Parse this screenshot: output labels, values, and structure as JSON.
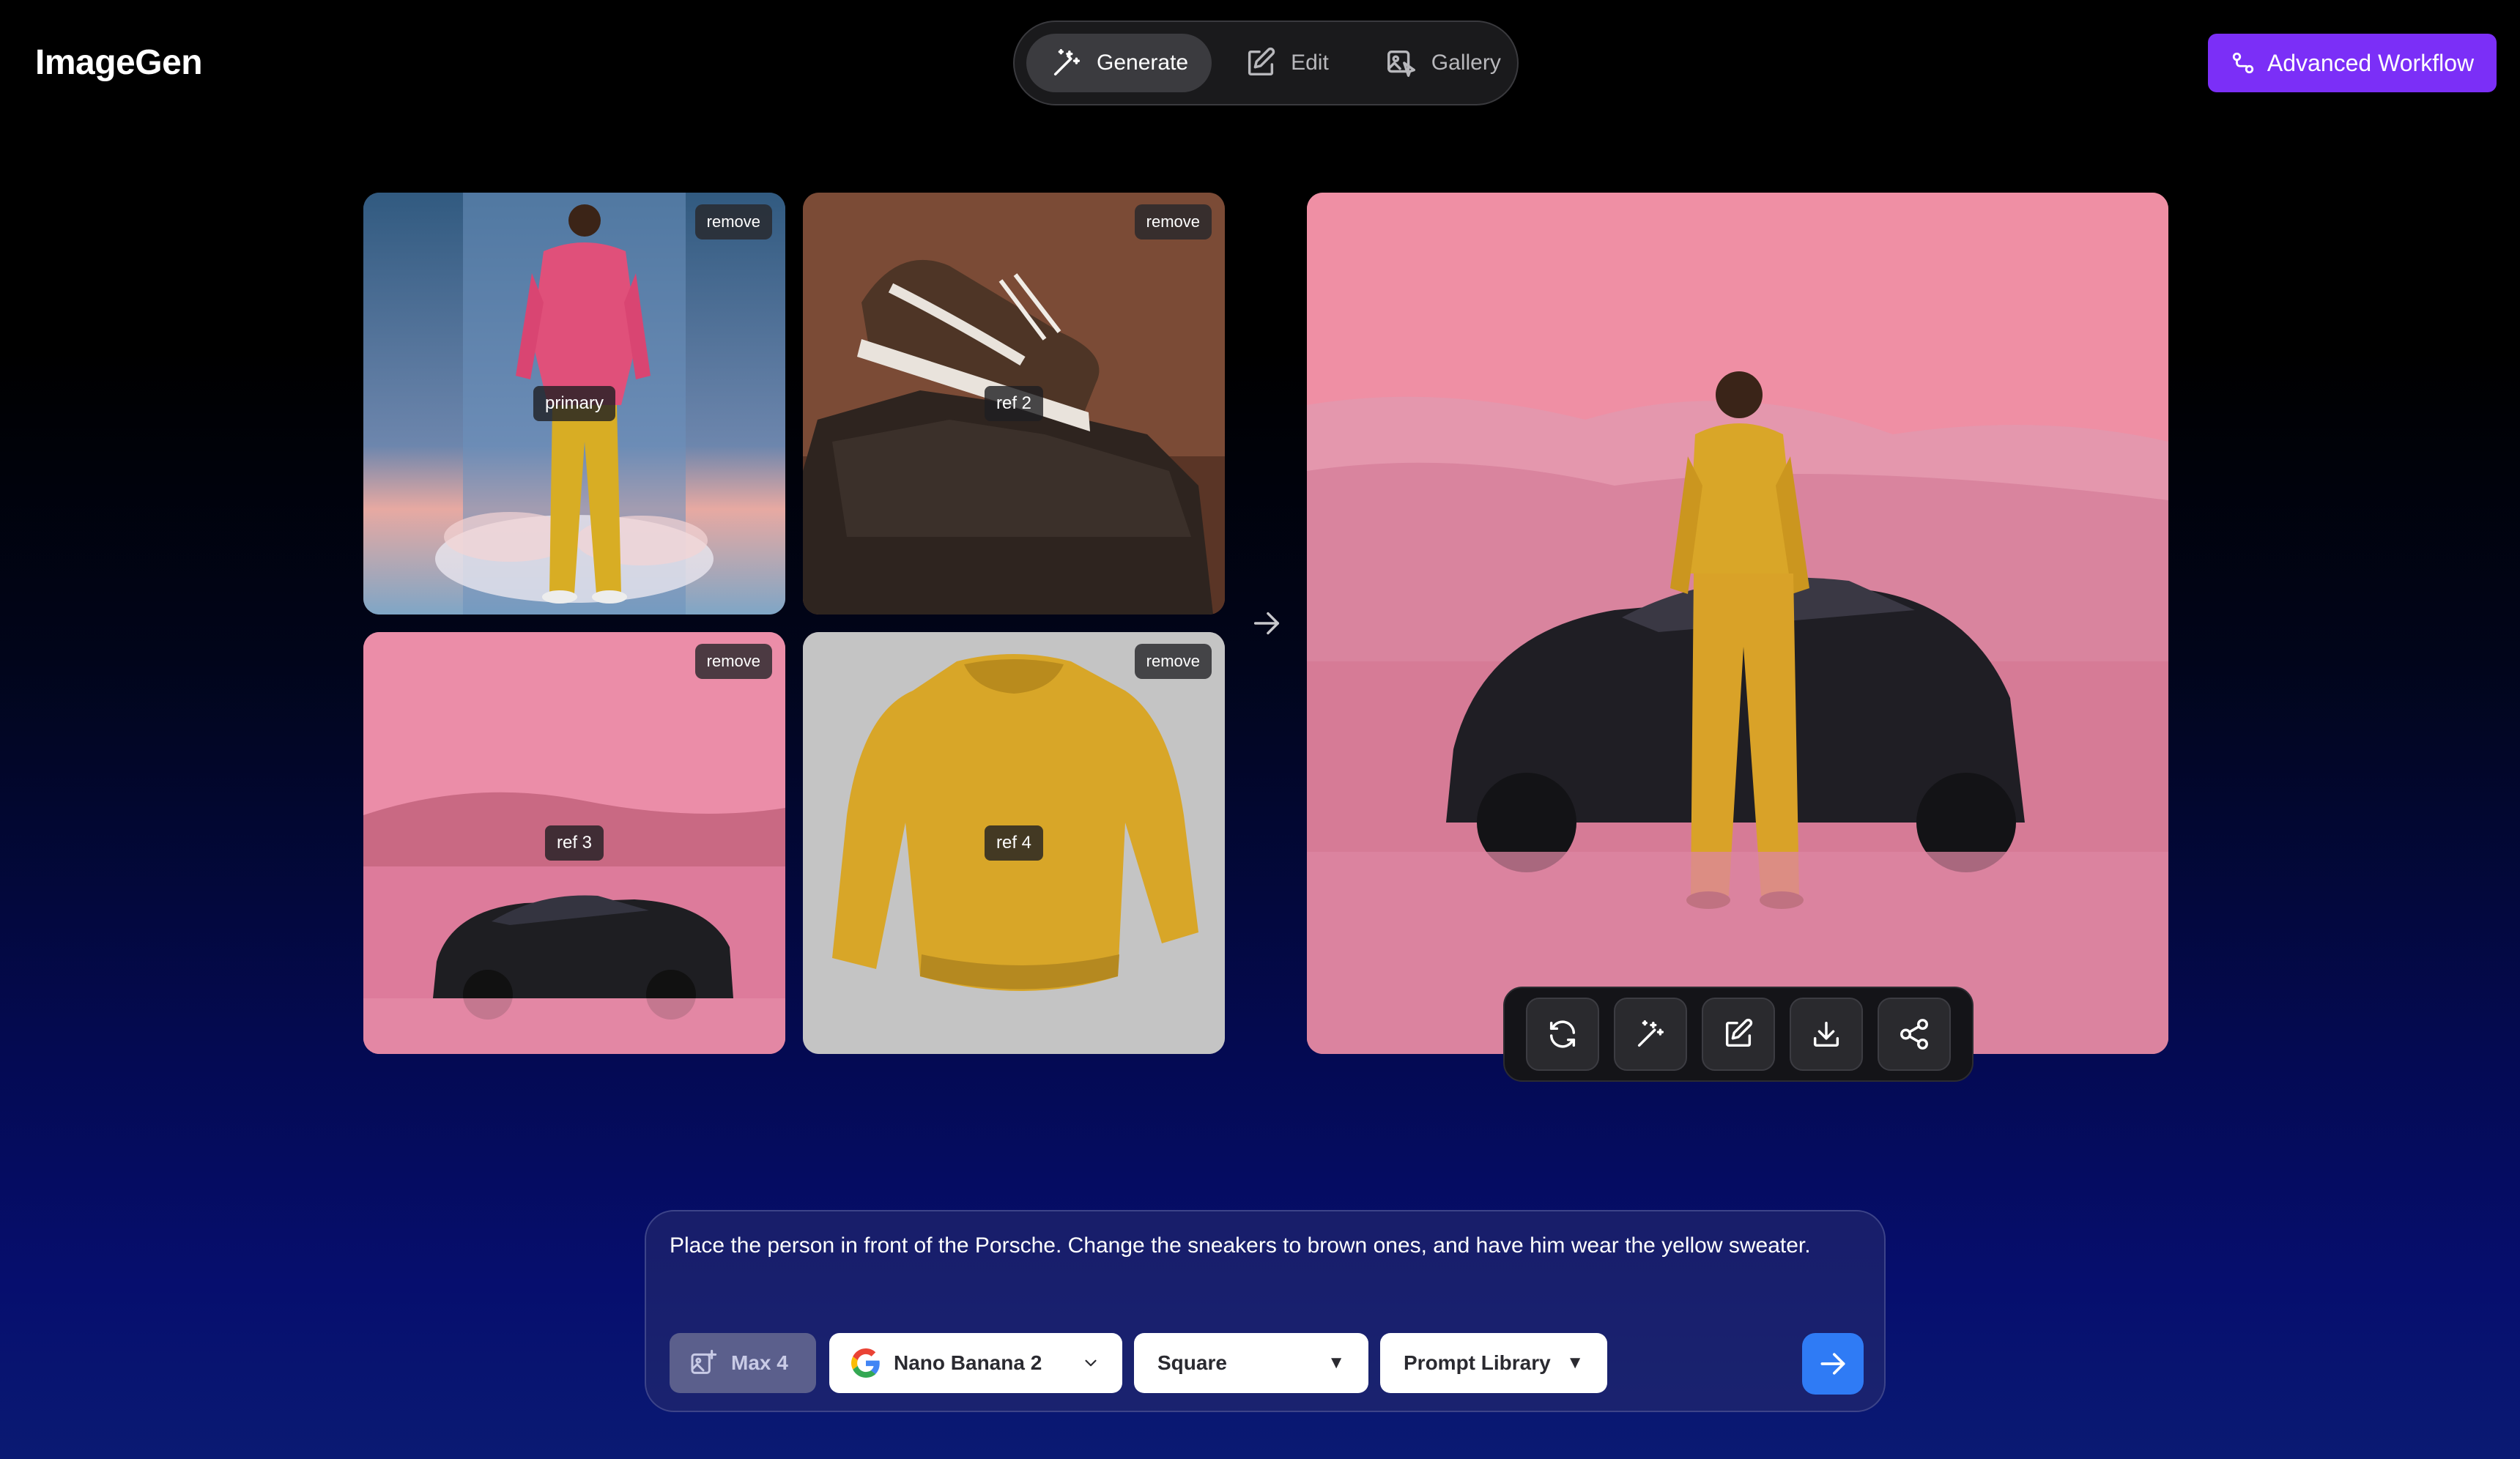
{
  "app": {
    "title": "ImageGen"
  },
  "nav": {
    "tabs": [
      {
        "label": "Generate",
        "icon": "magic-wand-icon",
        "active": true
      },
      {
        "label": "Edit",
        "icon": "edit-icon",
        "active": false
      },
      {
        "label": "Gallery",
        "icon": "gallery-icon",
        "active": false
      }
    ]
  },
  "header": {
    "advanced_label": "Advanced Workflow",
    "advanced_icon": "workflow-icon",
    "accent": "#7b2ff7"
  },
  "references": {
    "remove_label": "remove",
    "tiles": [
      {
        "label": "primary"
      },
      {
        "label": "ref 2"
      },
      {
        "label": "ref 3"
      },
      {
        "label": "ref 4"
      }
    ]
  },
  "result_toolbar": {
    "icons": [
      "regenerate-icon",
      "magic-wand-icon",
      "edit-icon",
      "download-icon",
      "share-icon"
    ]
  },
  "prompt": {
    "text": "Place the person in front of the Porsche. Change the sneakers to brown ones, and have him wear the yellow sweater.",
    "max_label": "Max 4",
    "model": "Nano Banana 2",
    "aspect": "Square",
    "library_label": "Prompt Library",
    "send_color": "#2f7bf5"
  }
}
